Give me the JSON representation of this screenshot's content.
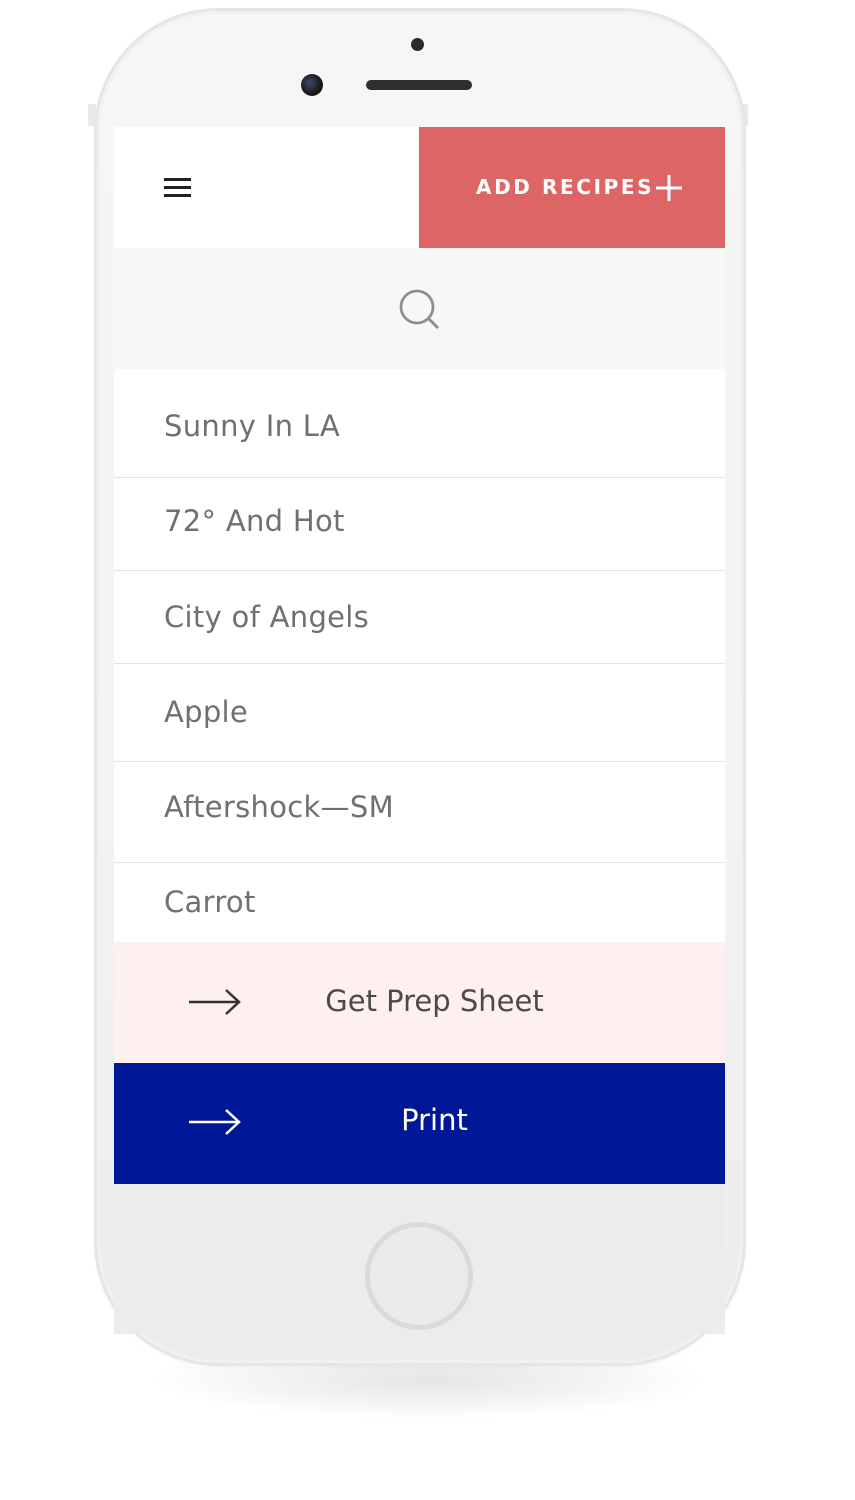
{
  "header": {
    "menu_icon": "hamburger-icon",
    "add_button_label": "ADD RECIPES",
    "add_icon": "plus-icon"
  },
  "search": {
    "icon": "search-icon"
  },
  "recipes": [
    "Sunny In LA",
    "72° And Hot",
    "City of Angels",
    "Apple",
    "Aftershock—SM",
    "Carrot"
  ],
  "actions": {
    "prep_sheet_label": "Get Prep Sheet",
    "print_label": "Print",
    "arrow_icon": "arrow-right-icon"
  },
  "colors": {
    "accent_red": "#dc6666",
    "print_blue": "#001898",
    "prep_background": "#fdf0ef",
    "search_background": "#f7f7f7",
    "list_text": "#707070"
  }
}
